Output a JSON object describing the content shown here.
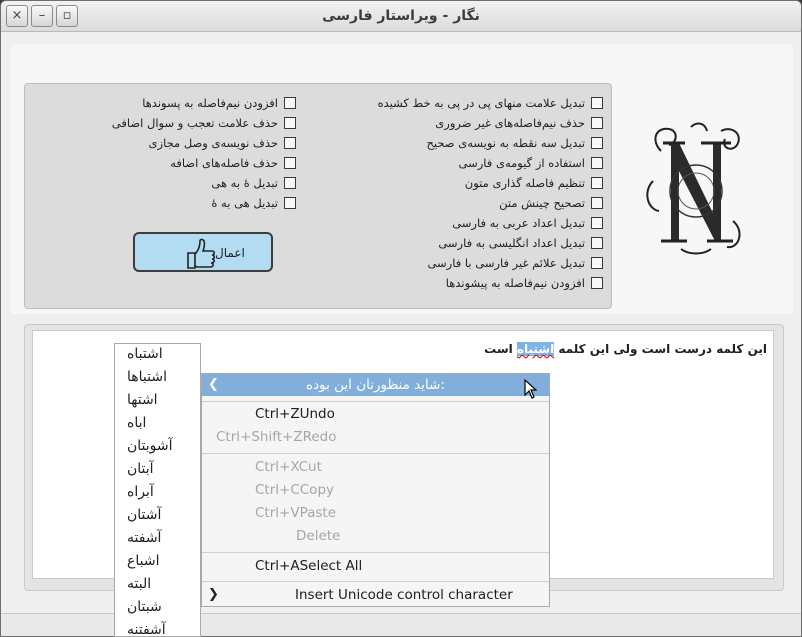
{
  "window": {
    "title": "نگار - ویراستار فارسی",
    "close_glyph": "×",
    "minimize_glyph": "–",
    "maximize_glyph": "▫"
  },
  "options_right": [
    "تبدیل علامت منهای پی در پی به خط کشیده",
    "حذف نیم‌فاصله‌های غیر ضروری",
    "تبدیل سه نقطه به نویسه‌ی صحیح",
    "استفاده از گیومه‌ی فارسی",
    "تنظیم فاصله گذاری متون",
    "تصحیح چینش متن",
    "تبدیل اعداد عربی به فارسی",
    "تبدیل اعداد انگلیسی به فارسی",
    "تبدیل علائم غیر فارسی با فارسی",
    "افزودن نیم‌فاصله به پیشوندها"
  ],
  "options_left": [
    "افزودن نیم‌فاصله به پسوندها",
    "حذف علامت تعجب و سوال اضافی",
    "حذف نویسه‌ی وصل مجازی",
    "حذف فاصله‌های اضافه",
    "تبدیل هٔ به هی",
    "تبدیل هی به هٔ"
  ],
  "apply_button": {
    "label": "اعمال",
    "icon": "thumbs-up-icon"
  },
  "logo": {
    "icon": "ornamental-letter-n-logo"
  },
  "editor": {
    "text_before": "این کلمه درست است ولی این کلمه ",
    "misspelled": "اشتباه",
    "text_after": " است"
  },
  "context_menu": {
    "suggestions_label": "شاید منظورتان این بوده:",
    "undo": "Ctrl+ZUndo",
    "redo": "Ctrl+Shift+ZRedo",
    "cut": "Ctrl+XCut",
    "copy": "Ctrl+CCopy",
    "paste": "Ctrl+VPaste",
    "delete": "Delete",
    "select_all": "Ctrl+ASelect All",
    "unicode": "Insert Unicode control character",
    "submenu_glyph": "❯"
  },
  "suggestions": [
    "اشتباه",
    "اشتباها",
    "اشتها",
    "اباه",
    "آشوبتان",
    "آبتان",
    "آبراه",
    "آشتان",
    "آشفته",
    "اشباع",
    "البته",
    "شبتان",
    "آشفتنه"
  ],
  "colors": {
    "selection": "#7fb2e5",
    "apply_button": "#b3dcf2",
    "menu_highlight": "#82aedb"
  }
}
